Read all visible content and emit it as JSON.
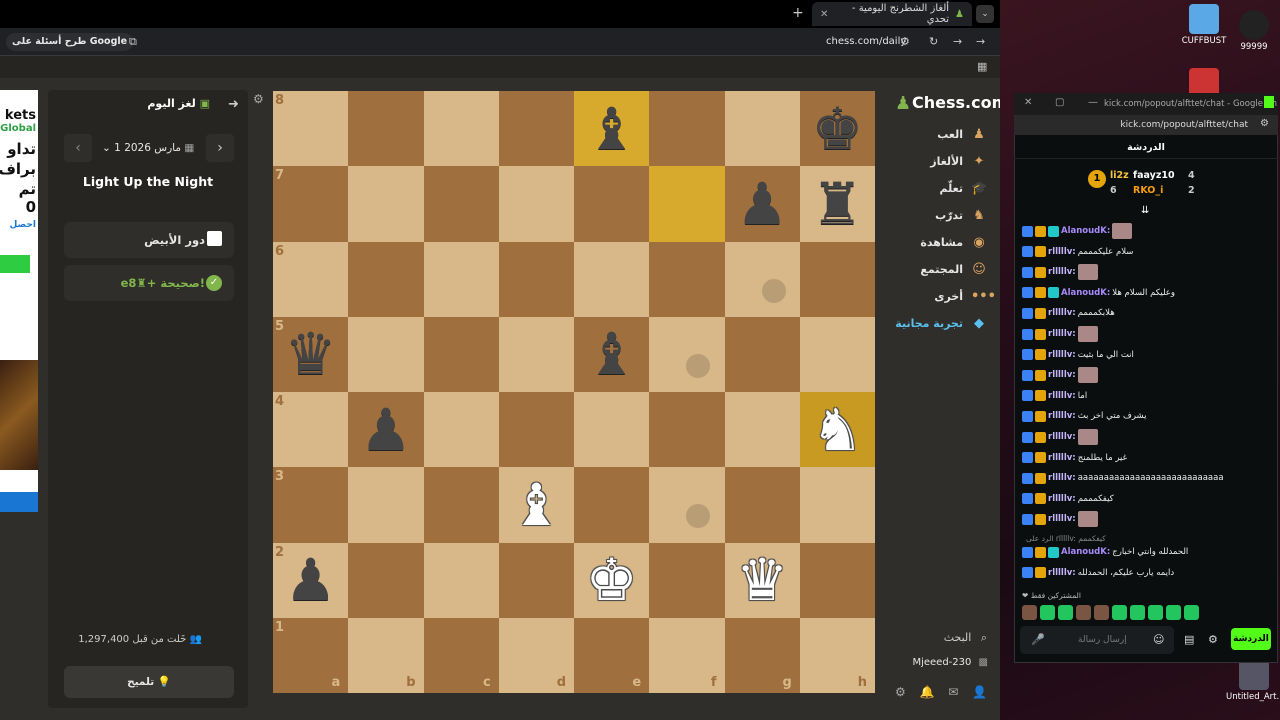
{
  "browser": {
    "tab_title": "ألغاز الشطرنج اليومية - تحدي",
    "new_tab": "+",
    "google_chip": "طرح أسئلة على Google",
    "url": "chess.com/daily"
  },
  "ad": {
    "line1": "kets",
    "line2": "Global",
    "line3": "تداو",
    "line4": "براف",
    "line5": "تم",
    "line6": "0",
    "line7": "احصل"
  },
  "puzzle": {
    "title": "لغز اليوم",
    "date": "1 مارس 2026",
    "name": "Light Up the Night",
    "turn": "دور الأبيض",
    "move_result": "e8♜+ صحيحة!",
    "solved_count": "خَلت من قبل 1,297,400",
    "hint": "تلميح"
  },
  "board": {
    "ranks": [
      "8",
      "7",
      "6",
      "5",
      "4",
      "3",
      "2",
      "1"
    ],
    "files": [
      "a",
      "b",
      "c",
      "d",
      "e",
      "f",
      "g",
      "h"
    ],
    "pieces": [
      {
        "sq": "e8",
        "glyph": "♝",
        "color": "b"
      },
      {
        "sq": "h8",
        "glyph": "♚",
        "color": "b"
      },
      {
        "sq": "g7",
        "glyph": "♟",
        "color": "b"
      },
      {
        "sq": "h7",
        "glyph": "♜",
        "color": "b"
      },
      {
        "sq": "a5",
        "glyph": "♛",
        "color": "b"
      },
      {
        "sq": "e5",
        "glyph": "♝",
        "color": "b"
      },
      {
        "sq": "b4",
        "glyph": "♟",
        "color": "b"
      },
      {
        "sq": "h4",
        "glyph": "♞",
        "color": "w"
      },
      {
        "sq": "d3",
        "glyph": "♝",
        "color": "w"
      },
      {
        "sq": "a2",
        "glyph": "♟",
        "color": "b"
      },
      {
        "sq": "e2",
        "glyph": "♚",
        "color": "w"
      },
      {
        "sq": "g2",
        "glyph": "♛",
        "color": "w"
      }
    ],
    "highlights": [
      "e8",
      "f7",
      "h4"
    ],
    "dots": [
      "g6",
      "f5",
      "f3"
    ]
  },
  "nav": {
    "logo": "Chess.com",
    "items": [
      {
        "label": "العب",
        "icon": "play-icon",
        "glyph": "♟"
      },
      {
        "label": "الألغاز",
        "icon": "puzzle-icon",
        "glyph": "✦"
      },
      {
        "label": "تعلّم",
        "icon": "learn-icon",
        "glyph": "🎓"
      },
      {
        "label": "تدرّب",
        "icon": "train-icon",
        "glyph": "♞"
      },
      {
        "label": "مشاهدة",
        "icon": "watch-icon",
        "glyph": "◉"
      },
      {
        "label": "المجتمع",
        "icon": "community-icon",
        "glyph": "☺"
      },
      {
        "label": "أخرى",
        "icon": "more-icon",
        "glyph": "•••"
      },
      {
        "label": "تجربة مجانية",
        "icon": "diamond-icon",
        "glyph": "◆"
      }
    ],
    "search": "البحث",
    "username": "Mjeeed-230"
  },
  "desktop": {
    "icon1": "CUFFBUST",
    "icon2": "99999",
    "icon3": "Untitled_Art..."
  },
  "chat": {
    "window_title": "kick.com/popout/alfttet/chat - Google Ch...",
    "url": "kick.com/popout/alfttet/chat",
    "header": "الدردشة",
    "leaderboard": [
      {
        "name": "faayz10",
        "count": "4"
      },
      {
        "name": "li2z",
        "count": ""
      },
      {
        "name": "RKO_i",
        "count": "2"
      },
      {
        "name": "",
        "count": "6"
      }
    ],
    "messages": [
      {
        "user": "AlanoudK:",
        "text": "",
        "color": "#a78bfa",
        "emote": true,
        "cyan": true
      },
      {
        "user": "rlllllv:",
        "text": "سلام عليكمممم",
        "color": "#c4b5fd",
        "emote": false,
        "cyan": false
      },
      {
        "user": "rlllllv:",
        "text": "",
        "color": "#c4b5fd",
        "emote": true,
        "cyan": false
      },
      {
        "user": "AlanoudK:",
        "text": "وعليكم السلام هلا",
        "color": "#a78bfa",
        "emote": false,
        "cyan": true
      },
      {
        "user": "rlllllv:",
        "text": "هلابكمممم",
        "color": "#c4b5fd",
        "emote": false,
        "cyan": false
      },
      {
        "user": "rlllllv:",
        "text": "",
        "color": "#c4b5fd",
        "emote": true,
        "cyan": false
      },
      {
        "user": "rlllllv:",
        "text": "انت الي ما بثيت",
        "color": "#c4b5fd",
        "emote": false,
        "cyan": false
      },
      {
        "user": "rlllllv:",
        "text": "",
        "color": "#c4b5fd",
        "emote": true,
        "cyan": false
      },
      {
        "user": "rlllllv:",
        "text": "اما",
        "color": "#c4b5fd",
        "emote": false,
        "cyan": false
      },
      {
        "user": "rlllllv:",
        "text": "يشرف متي اخر بث",
        "color": "#c4b5fd",
        "emote": false,
        "cyan": false
      },
      {
        "user": "rlllllv:",
        "text": "",
        "color": "#c4b5fd",
        "emote": true,
        "cyan": false
      },
      {
        "user": "rlllllv:",
        "text": "غير ما يطلمنج",
        "color": "#c4b5fd",
        "emote": false,
        "cyan": false
      },
      {
        "user": "rlllllv:",
        "text": "aaaaaaaaaaaaaaaaaaaaaaaaaaaa",
        "color": "#c4b5fd",
        "emote": false,
        "cyan": false
      },
      {
        "user": "rlllllv:",
        "text": "كيفكمممم",
        "color": "#c4b5fd",
        "emote": false,
        "cyan": false
      },
      {
        "user": "rlllllv:",
        "text": "",
        "color": "#c4b5fd",
        "emote": true,
        "cyan": false
      },
      {
        "user": "AlanoudK:",
        "text": "الحمدلله وانتي اخبارج",
        "color": "#a78bfa",
        "emote": false,
        "cyan": true
      },
      {
        "user": "rlllllv:",
        "text": "دايمه يارب عليكم، الحمدلله",
        "color": "#c4b5fd",
        "emote": false,
        "cyan": false
      }
    ],
    "reply_note": "الرد على rlllllv: كيفكممم",
    "subs_label": "المشتركين فقط",
    "input_placeholder": "إرسال رسالة",
    "send": "الدردشة",
    "accent": "#53fc18"
  }
}
